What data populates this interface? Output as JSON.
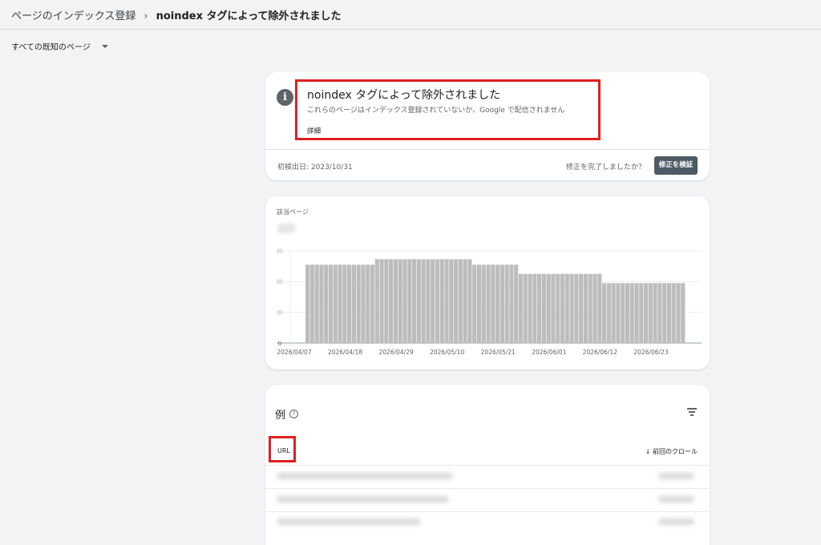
{
  "breadcrumb": {
    "parent": "ページのインデックス登録",
    "separator": "›",
    "current": "noindex タグによって除外されました"
  },
  "filter": {
    "label": "すべての既知のページ"
  },
  "issue": {
    "icon": "info-icon",
    "title": "noindex タグによって除外されました",
    "description": "これらのページはインデックス登録されていないか、Google で配信されません",
    "details_link": "詳細",
    "first_detected": "初検出日: 2023/10/31",
    "fix_question": "修正を完了しましたか？",
    "validate_button": "修正を検証",
    "highlight_color": "#e01f1f"
  },
  "chart_data": {
    "type": "bar",
    "title": "該当ページ",
    "x_tick_labels": [
      "2026/04/07",
      "2026/04/18",
      "2026/04/29",
      "2026/05/10",
      "2026/05/21",
      "2026/06/01",
      "2026/06/12",
      "2026/06/23"
    ],
    "y_zero_label": "0",
    "ylim": [
      0,
      100
    ],
    "grid": true,
    "bar_color": "#bdbdbd",
    "series": [
      {
        "values": [
          85,
          85,
          85,
          85,
          85,
          85,
          85,
          85,
          85,
          85,
          85,
          85,
          85,
          85,
          85,
          91,
          91,
          91,
          91,
          91,
          91,
          91,
          91,
          91,
          91,
          91,
          91,
          91,
          91,
          91,
          91,
          91,
          91,
          91,
          91,
          91,
          85,
          85,
          85,
          85,
          85,
          85,
          85,
          85,
          85,
          85,
          75,
          75,
          75,
          75,
          75,
          75,
          75,
          75,
          75,
          75,
          75,
          75,
          75,
          75,
          75,
          75,
          75,
          75,
          65,
          65,
          65,
          65,
          65,
          65,
          65,
          65,
          65,
          65,
          65,
          65,
          65,
          65,
          65,
          65,
          65,
          65
        ]
      }
    ]
  },
  "examples": {
    "title": "例",
    "help_icon": "help-circle-icon",
    "filter_icon": "filter-list-icon",
    "columns": {
      "url": "URL",
      "last_crawl": "前回のクロール"
    },
    "sort_icon": "arrow-down-icon",
    "rows": 3
  }
}
